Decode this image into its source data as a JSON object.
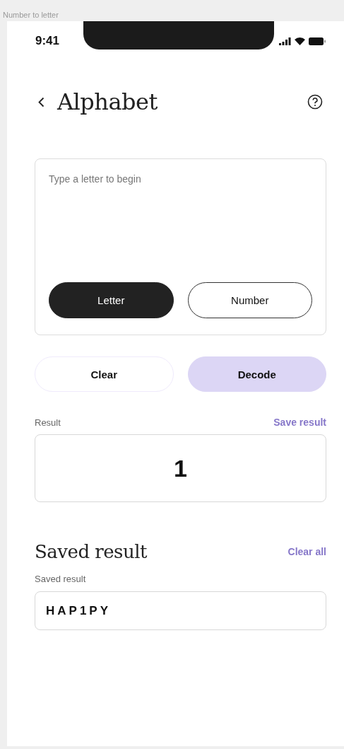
{
  "frame_label": "Number to letter",
  "status_bar": {
    "time": "9:41"
  },
  "header": {
    "title": "Alphabet"
  },
  "input": {
    "placeholder": "Type a letter to begin"
  },
  "modes": [
    {
      "label": "Letter",
      "selected": true
    },
    {
      "label": "Number",
      "selected": false
    }
  ],
  "actions": [
    {
      "label": "Clear",
      "kind": "secondary"
    },
    {
      "label": "Decode",
      "kind": "primary"
    }
  ],
  "result": {
    "label": "Result",
    "link": "Save result",
    "value": "1"
  },
  "saved": {
    "heading": "Saved result",
    "link": "Clear all",
    "label": "Saved result",
    "value": "HAP1PY"
  }
}
